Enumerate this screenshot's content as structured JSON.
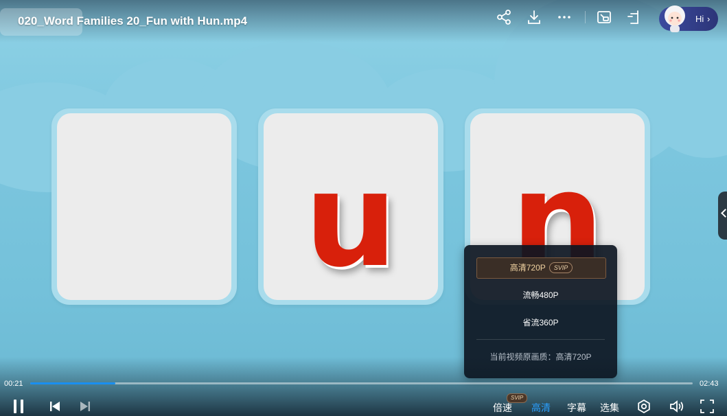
{
  "header": {
    "video_title": "020_Word Families 20_Fun with Hun.mp4",
    "icons": [
      "share-icon",
      "download-icon",
      "more-icon",
      "picture-in-picture-icon",
      "mini-window-icon"
    ],
    "assistant_label": "Hi"
  },
  "video": {
    "letters": [
      "",
      "u",
      "n"
    ],
    "letter_color": "#d8200b"
  },
  "quality_menu": {
    "options": [
      {
        "label": "高清720P",
        "badge": "SVIP",
        "selected": true
      },
      {
        "label": "流畅480P",
        "badge": "",
        "selected": false
      },
      {
        "label": "省流360P",
        "badge": "",
        "selected": false
      }
    ],
    "current_quality_note": "当前视频原画质：高清720P"
  },
  "controls": {
    "current_time": "00:21",
    "total_time": "02:43",
    "progress": 0.128,
    "speed_label": "倍速",
    "speed_badge": "SVIP",
    "quality_label": "高清",
    "subtitle_label": "字幕",
    "episodes_label": "选集",
    "accent_color": "#1a8ff0"
  }
}
